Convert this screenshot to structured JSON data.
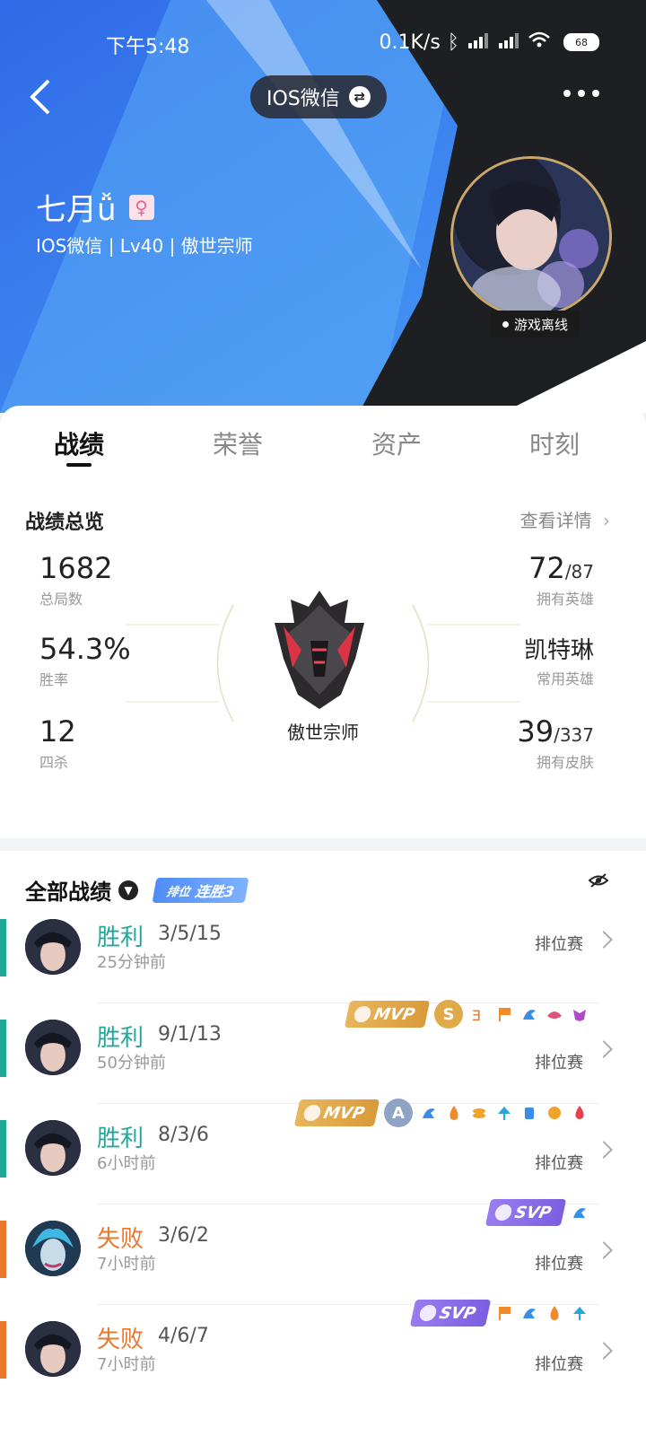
{
  "status_bar": {
    "time": "下午5:48",
    "network": "0.1K/s",
    "battery": "68"
  },
  "header": {
    "switch_label": "IOS微信",
    "name": "七月ǚ",
    "subinfo": "IOS微信 | Lv40 | 傲世宗师",
    "status": "游戏离线"
  },
  "tabs": [
    "战绩",
    "荣誉",
    "资产",
    "时刻"
  ],
  "overview": {
    "title": "战绩总览",
    "details_link": "查看详情",
    "total_games": {
      "value": "1682",
      "label": "总局数"
    },
    "win_rate": {
      "value": "54.3%",
      "label": "胜率"
    },
    "quadra_kills": {
      "value": "12",
      "label": "四杀"
    },
    "heroes_owned": {
      "value": "72",
      "total": "/87",
      "label": "拥有英雄"
    },
    "main_hero": {
      "value": "凯特琳",
      "label": "常用英雄"
    },
    "skins_owned": {
      "value": "39",
      "total": "/337",
      "label": "拥有皮肤"
    },
    "rank": "傲世宗师"
  },
  "records": {
    "title": "全部战绩",
    "streak_prefix": "排位",
    "streak": "连胜3",
    "rows": [
      {
        "result": "胜利",
        "kda": "3/5/15",
        "time": "25分钟前",
        "mode": "排位赛",
        "outcome": "win"
      },
      {
        "result": "胜利",
        "kda": "9/1/13",
        "time": "50分钟前",
        "mode": "排位赛",
        "outcome": "win",
        "award": "MVP",
        "grade": "S"
      },
      {
        "result": "胜利",
        "kda": "8/3/6",
        "time": "6小时前",
        "mode": "排位赛",
        "outcome": "win",
        "award": "MVP",
        "grade": "A"
      },
      {
        "result": "失败",
        "kda": "3/6/2",
        "time": "7小时前",
        "mode": "排位赛",
        "outcome": "loss",
        "award": "SVP"
      },
      {
        "result": "失败",
        "kda": "4/6/7",
        "time": "7小时前",
        "mode": "排位赛",
        "outcome": "loss",
        "award": "SVP"
      }
    ]
  },
  "colors": {
    "win": "#1fa79a",
    "loss": "#e8782e",
    "header_blue": "#3a78ee",
    "mvp_gold": "#e0a94a",
    "svp_purple": "#8a6ce8"
  }
}
